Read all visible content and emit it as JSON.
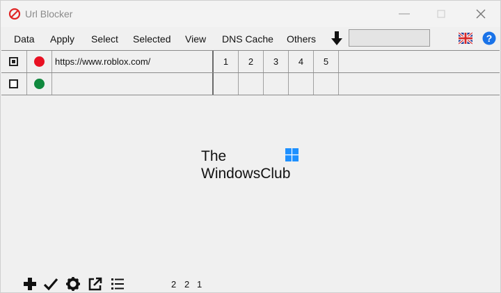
{
  "window": {
    "title": "Url Blocker"
  },
  "menu": {
    "items": [
      {
        "id": "data",
        "label": "Data"
      },
      {
        "id": "apply",
        "label": "Apply"
      },
      {
        "id": "select",
        "label": "Select"
      },
      {
        "id": "selected",
        "label": "Selected"
      },
      {
        "id": "view",
        "label": "View"
      },
      {
        "id": "dns-cache",
        "label": "DNS Cache"
      },
      {
        "id": "others",
        "label": "Others"
      }
    ],
    "download_field_value": ""
  },
  "rows": [
    {
      "selected": true,
      "status": "blocked",
      "status_color": "#e81123",
      "url": "https://www.roblox.com/"
    },
    {
      "selected": false,
      "status": "allowed",
      "status_color": "#10893e",
      "url": ""
    }
  ],
  "columns": [
    "1",
    "2",
    "3",
    "4",
    "5"
  ],
  "watermark": {
    "line1": "The",
    "line2": "WindowsClub"
  },
  "footer": {
    "counters": [
      "2",
      "2",
      "1"
    ]
  },
  "colors": {
    "help": "#1a73e8",
    "watermark_blue": "#1e90ff"
  }
}
